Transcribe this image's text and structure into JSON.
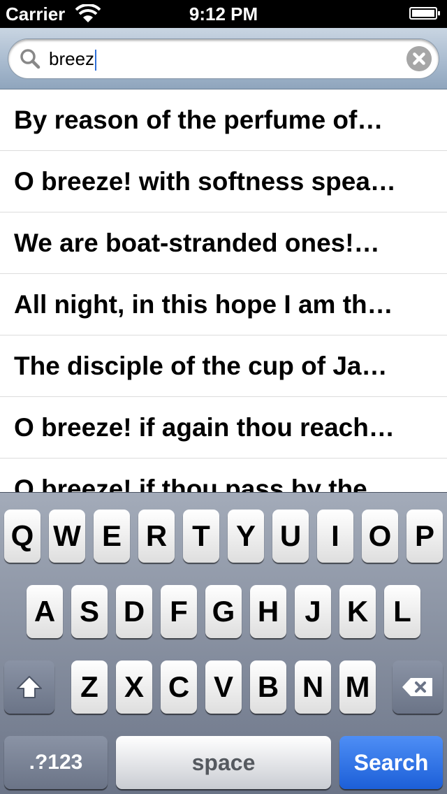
{
  "status_bar": {
    "carrier": "Carrier",
    "time": "9:12 PM"
  },
  "search": {
    "query": "breez"
  },
  "results": [
    "By reason of the perfume of…",
    "O breeze! with softness spea…",
    "We are boat-stranded ones!…",
    "All night, in this hope I am th…",
    "The disciple of the cup of Ja…",
    "O breeze! if again thou reach…",
    "O breeze! if thou pass by the"
  ],
  "keyboard": {
    "row1": [
      "Q",
      "W",
      "E",
      "R",
      "T",
      "Y",
      "U",
      "I",
      "O",
      "P"
    ],
    "row2": [
      "A",
      "S",
      "D",
      "F",
      "G",
      "H",
      "J",
      "K",
      "L"
    ],
    "row3": [
      "Z",
      "X",
      "C",
      "V",
      "B",
      "N",
      "M"
    ],
    "numbers_label": ".?123",
    "space_label": "space",
    "search_label": "Search",
    "shift_icon": "shift-icon",
    "delete_icon": "backspace-icon"
  },
  "colors": {
    "search_key": "#2f6fe0",
    "searchbar_tint": "#a9bbcf",
    "keyboard_bg": "#7b8497"
  }
}
